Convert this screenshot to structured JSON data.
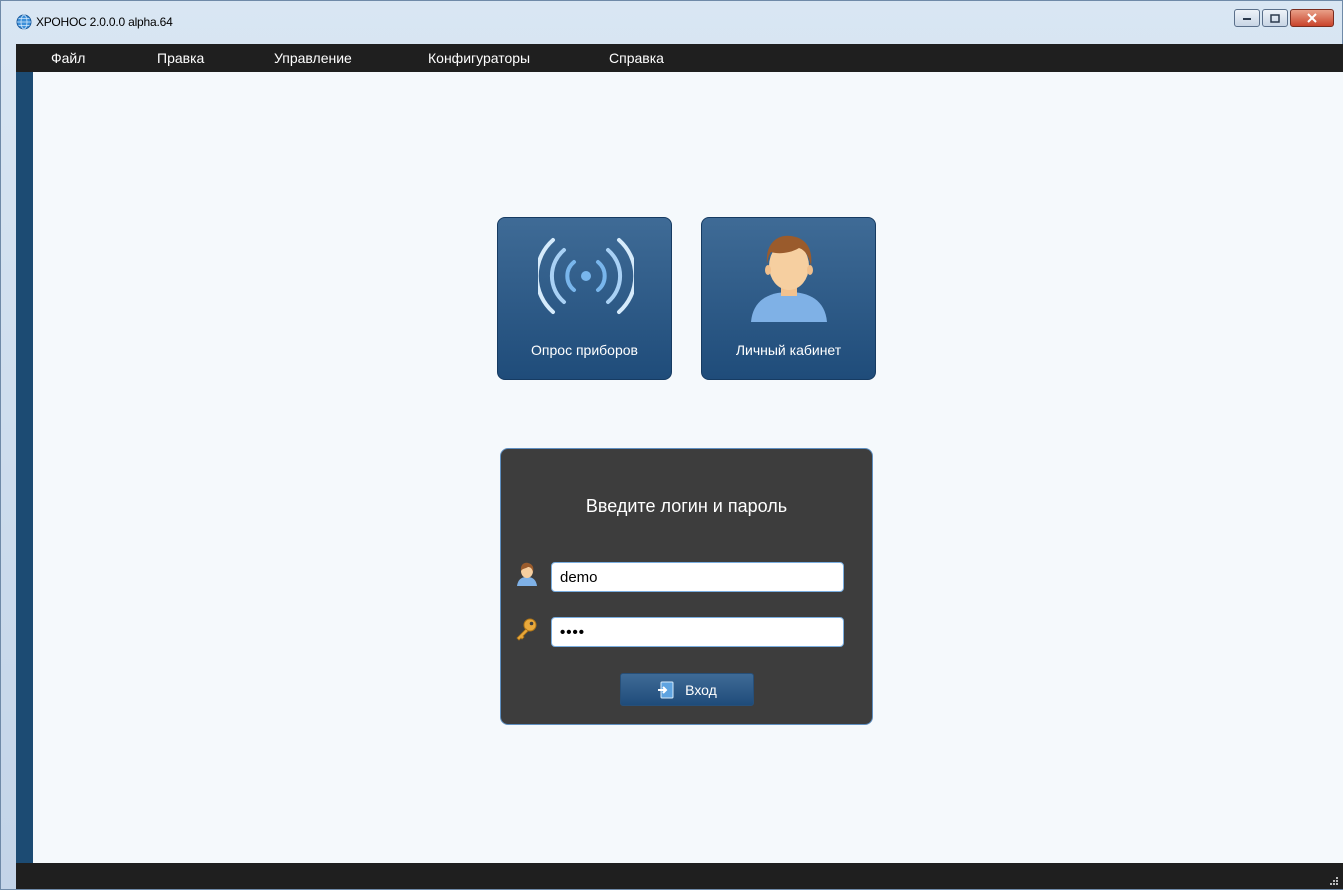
{
  "window": {
    "title": "ХРОНОС 2.0.0.0 alpha.64",
    "controls": {
      "minimize": "minimize",
      "maximize": "maximize",
      "close": "close"
    }
  },
  "menu": {
    "items": [
      "Файл",
      "Правка",
      "Управление",
      "Конфигураторы",
      "Справка"
    ]
  },
  "tiles": {
    "devices": {
      "label": "Опрос приборов",
      "icon": "wireless-signal-icon"
    },
    "account": {
      "label": "Личный кабинет",
      "icon": "user-avatar-icon"
    }
  },
  "login": {
    "title": "Введите логин и пароль",
    "username_value": "demo",
    "password_value": "••••",
    "button_label": "Вход",
    "user_icon": "user-icon",
    "key_icon": "key-icon",
    "enter_icon": "enter-icon"
  },
  "colors": {
    "menubar": "#1f1f1f",
    "leftbar": "#1c4b73",
    "tile_top": "#3f6b96",
    "tile_bottom": "#1f4c7a",
    "panel": "#3d3d3d",
    "panel_border": "#5f8fc0",
    "content_bg": "#f5f9fc"
  }
}
